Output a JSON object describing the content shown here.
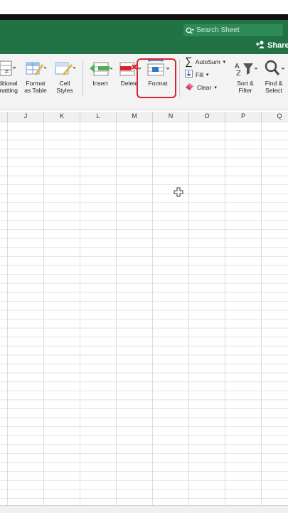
{
  "search": {
    "placeholder": "Search Sheet"
  },
  "share_label": "Share",
  "ribbon": {
    "conditional": "ditional\nmatting",
    "format_table": "Format\nas Table",
    "cell_styles": "Cell\nStyles",
    "insert": "Insert",
    "delete": "Delete",
    "format": "Format",
    "autosum": "AutoSum",
    "fill": "Fill",
    "clear": "Clear",
    "sort_filter": "Sort &\nFilter",
    "find_select": "Find &\nSelect"
  },
  "columns": [
    "J",
    "K",
    "L",
    "M",
    "N",
    "O",
    "P",
    "Q"
  ],
  "colors": {
    "green": "#217346",
    "highlight": "#d9232e"
  }
}
